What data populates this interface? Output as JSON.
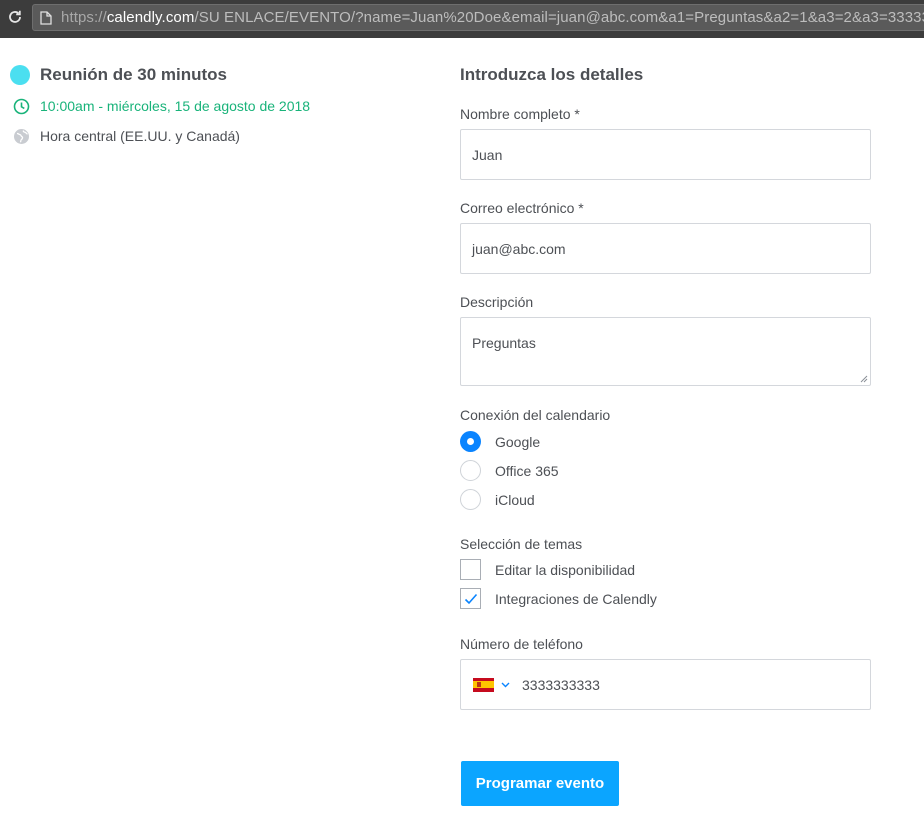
{
  "browser": {
    "url_scheme": "https://",
    "url_host": "calendly.com",
    "url_rest": "/SU ENLACE/EVENTO/?name=Juan%20Doe&email=juan@abc.com&a1=Preguntas&a2=1&a3=2&a3=33333333..."
  },
  "event": {
    "title": "Reunión de 30 minutos",
    "time": "10:00am - miércoles, 15 de agosto de 2018",
    "timezone": "Hora central (EE.UU. y Canadá)",
    "color": "#4bdff0"
  },
  "form": {
    "heading": "Introduzca los detalles",
    "name_label": "Nombre completo *",
    "name_value": "Juan",
    "email_label": "Correo electrónico *",
    "email_value": "juan@abc.com",
    "description_label": "Descripción",
    "description_value": "Preguntas",
    "calendar_label": "Conexión del calendario",
    "calendar_options": [
      {
        "label": "Google",
        "selected": true
      },
      {
        "label": "Office 365",
        "selected": false
      },
      {
        "label": "iCloud",
        "selected": false
      }
    ],
    "topics_label": "Selección de temas",
    "topics_options": [
      {
        "label": "Editar la disponibilidad",
        "checked": false
      },
      {
        "label": "Integraciones de Calendly",
        "checked": true
      }
    ],
    "phone_label": "Número de teléfono",
    "phone_country": "spain-flag-icon",
    "phone_value": "3333333333",
    "submit_label": "Programar evento"
  },
  "colors": {
    "accent": "#0ba5ff",
    "radio_selected": "#0a84ff",
    "time_green": "#19b37a"
  }
}
